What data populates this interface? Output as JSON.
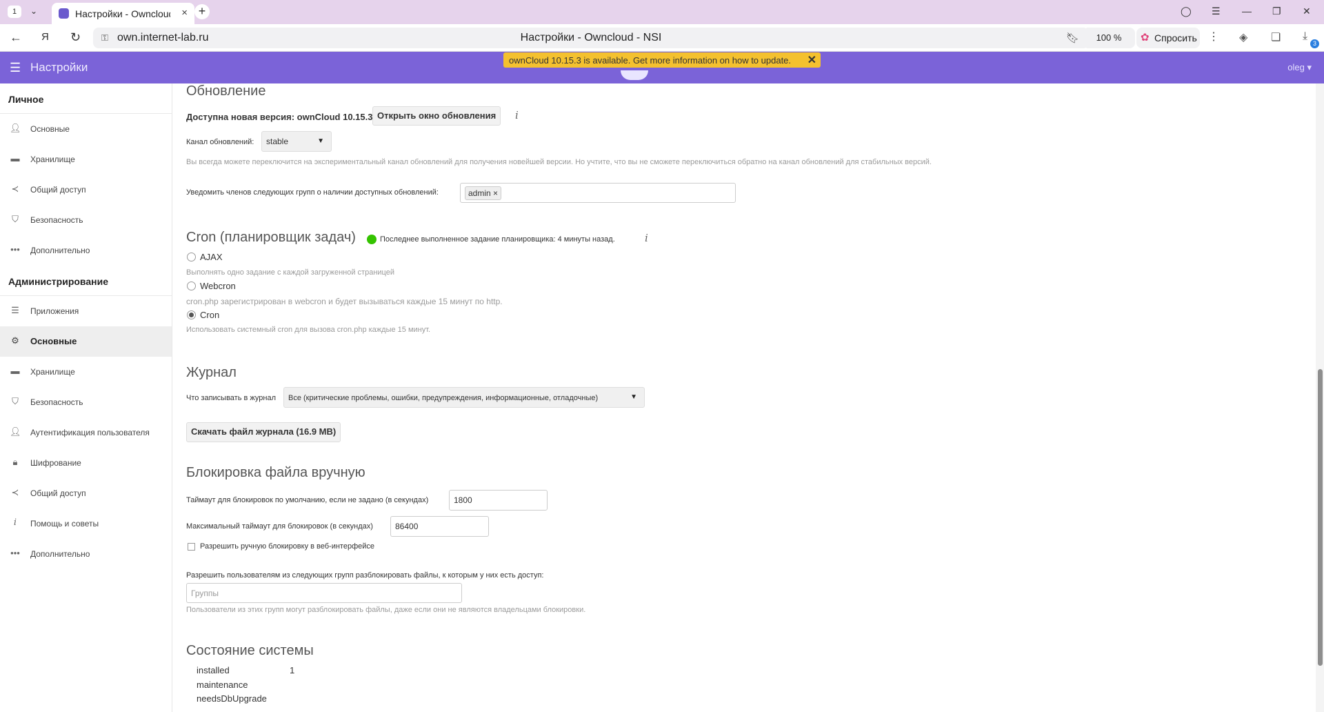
{
  "browser": {
    "tab_count": "1",
    "tab_title": "Настройки - Owncloud",
    "url": "own.internet-lab.ru",
    "page_title": "Настройки - Owncloud - NSI",
    "zoom": "100 %",
    "ask_label": "Спросить",
    "download_badge": "3"
  },
  "header": {
    "title": "Настройки",
    "user": "oleg ▾",
    "update_banner": "ownCloud 10.15.3 is available. Get more information on how to update.",
    "close_glyph": "✕",
    "brand_color": "#7b63d8",
    "banner_color": "#f4c12f"
  },
  "sidebar": {
    "personal_heading": "Личное",
    "personal_items": [
      {
        "label": "Основные",
        "icon": "user-icon"
      },
      {
        "label": "Хранилище",
        "icon": "folder-icon"
      },
      {
        "label": "Общий доступ",
        "icon": "share-icon"
      },
      {
        "label": "Безопасность",
        "icon": "shield-icon"
      },
      {
        "label": "Дополнительно",
        "icon": "more-icon"
      }
    ],
    "admin_heading": "Администрирование",
    "admin_items": [
      {
        "label": "Приложения",
        "icon": "list-icon"
      },
      {
        "label": "Основные",
        "icon": "gear-icon",
        "active": true
      },
      {
        "label": "Хранилище",
        "icon": "folder-icon"
      },
      {
        "label": "Безопасность",
        "icon": "shield-icon"
      },
      {
        "label": "Аутентификация пользователя",
        "icon": "user-icon"
      },
      {
        "label": "Шифрование",
        "icon": "lock-icon"
      },
      {
        "label": "Общий доступ",
        "icon": "share-icon"
      },
      {
        "label": "Помощь и советы",
        "icon": "info-icon"
      },
      {
        "label": "Дополнительно",
        "icon": "more-icon"
      }
    ]
  },
  "update": {
    "heading": "Обновление",
    "available_text": "Доступна новая версия: ownCloud 10.15.3",
    "open_button": "Открыть окно обновления",
    "channel_label": "Канал обновлений:",
    "channel_value": "stable",
    "channel_hint": "Вы всегда можете переключится на экспериментальный канал обновлений для получения новейшей версии. Но учтите, что вы не сможете переключиться обратно на канал обновлений для стабильных версий.",
    "notify_label": "Уведомить членов следующих групп о наличии доступных обновлений:",
    "notify_tag": "admin ×"
  },
  "cron": {
    "heading": "Cron (планировщик задач)",
    "status": "Последнее выполненное задание планировщика: 4 минуты назад.",
    "options": [
      {
        "label": "AJAX",
        "hint": "Выполнять одно задание с каждой загруженной страницей",
        "checked": false
      },
      {
        "label": "Webcron",
        "hint": "cron.php зарегистрирован в webcron и будет вызываться каждые 15 минут по http.",
        "checked": false
      },
      {
        "label": "Cron",
        "hint": "Использовать системный cron для вызова cron.php каждые 15 минут.",
        "checked": true
      }
    ]
  },
  "log": {
    "heading": "Журнал",
    "level_label": "Что записывать в журнал",
    "level_value": "Все (критические проблемы, ошибки, предупреждения, информационные, отладочные)",
    "download_button": "Скачать файл журнала (16.9 MB)"
  },
  "locking": {
    "heading": "Блокировка файла вручную",
    "default_timeout_label": "Таймаут для блокировок по умолчанию, если не задано (в секундах)",
    "default_timeout_value": "1800",
    "max_timeout_label": "Максимальный таймаут для блокировок (в секундах)",
    "max_timeout_value": "86400",
    "allow_manual_label": "Разрешить ручную блокировку в веб-интерфейсе",
    "groups_label": "Разрешить пользователям из следующих групп разблокировать файлы, к которым у них есть доступ:",
    "groups_placeholder": "Группы",
    "groups_hint": "Пользователи из этих групп могут разблокировать файлы, даже если они не являются владельцами блокировки."
  },
  "status": {
    "heading": "Состояние системы",
    "rows": [
      {
        "key": "installed",
        "value": "1"
      },
      {
        "key": "maintenance",
        "value": ""
      },
      {
        "key": "needsDbUpgrade",
        "value": ""
      }
    ]
  }
}
